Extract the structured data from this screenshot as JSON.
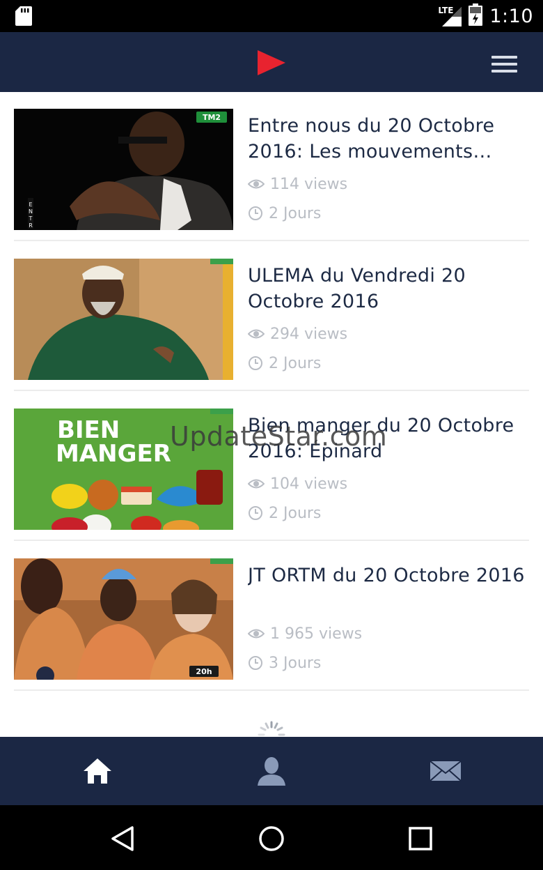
{
  "status_bar": {
    "network": "LTE",
    "time": "1:10"
  },
  "app_bar": {
    "logo_icon": "play-icon",
    "menu_icon": "hamburger-menu-icon"
  },
  "videos": [
    {
      "title": "Entre nous du 20 Octobre 2016: Les mouvements…",
      "views": "114 views",
      "age": "2 Jours",
      "thumb_badge": "TM2"
    },
    {
      "title": "ULEMA du Vendredi 20 Octobre 2016",
      "views": "294 views",
      "age": "2 Jours"
    },
    {
      "title": "Bien manger du 20 Octobre 2016: Épinard",
      "views": "104 views",
      "age": "2 Jours",
      "thumb_text_1": "BIEN",
      "thumb_text_2": "MANGER"
    },
    {
      "title": "JT ORTM du 20 Octobre 2016",
      "views": "1 965 views",
      "age": "3 Jours",
      "thumb_badge": "20h"
    }
  ],
  "watermark": "UpdateStar.com",
  "bottom_nav": [
    {
      "icon": "home-icon",
      "active": true
    },
    {
      "icon": "user-icon",
      "active": false
    },
    {
      "icon": "mail-icon",
      "active": false
    }
  ],
  "system_nav": [
    "back-icon",
    "home-circle-icon",
    "recents-icon"
  ],
  "colors": {
    "navy": "#1b2744",
    "accent_red": "#e8232f",
    "title_text": "#1d2a44",
    "meta_text": "#b9bdc4"
  }
}
